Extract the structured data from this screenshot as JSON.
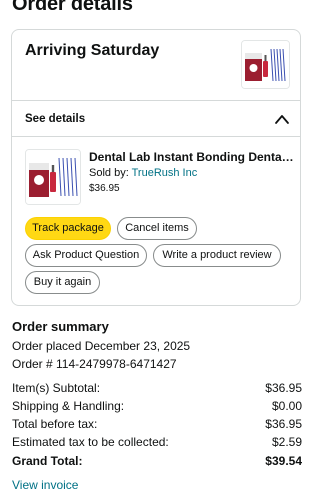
{
  "header": {
    "title": "Order details"
  },
  "shipment": {
    "status": "Arriving Saturday",
    "see_details_label": "See details"
  },
  "product": {
    "title": "Dental Lab Instant Bonding Dental Repair Kit",
    "sold_by_label": "Sold by:",
    "seller": "TrueRush Inc",
    "price": "$36.95"
  },
  "actions": {
    "track_package": "Track package",
    "cancel_items": "Cancel items",
    "ask_question": "Ask Product Question",
    "write_review": "Write a product review",
    "buy_again": "Buy it again"
  },
  "summary": {
    "title": "Order summary",
    "order_placed": "Order placed December 23, 2025",
    "order_number": "Order # 114-2479978-6471427",
    "rows": [
      {
        "label": "Item(s) Subtotal:",
        "value": "$36.95"
      },
      {
        "label": "Shipping & Handling:",
        "value": "$0.00"
      },
      {
        "label": "Total before tax:",
        "value": "$36.95"
      },
      {
        "label": "Estimated tax to be collected:",
        "value": "$2.59"
      },
      {
        "label": "Grand Total:",
        "value": "$39.54"
      }
    ],
    "view_invoice": "View invoice"
  },
  "colors": {
    "primary_button": "#ffd814",
    "link": "#007185",
    "border": "#d5d9d9",
    "product_red": "#b5253a"
  },
  "icons": {
    "collapse": "chevron-up-icon"
  }
}
